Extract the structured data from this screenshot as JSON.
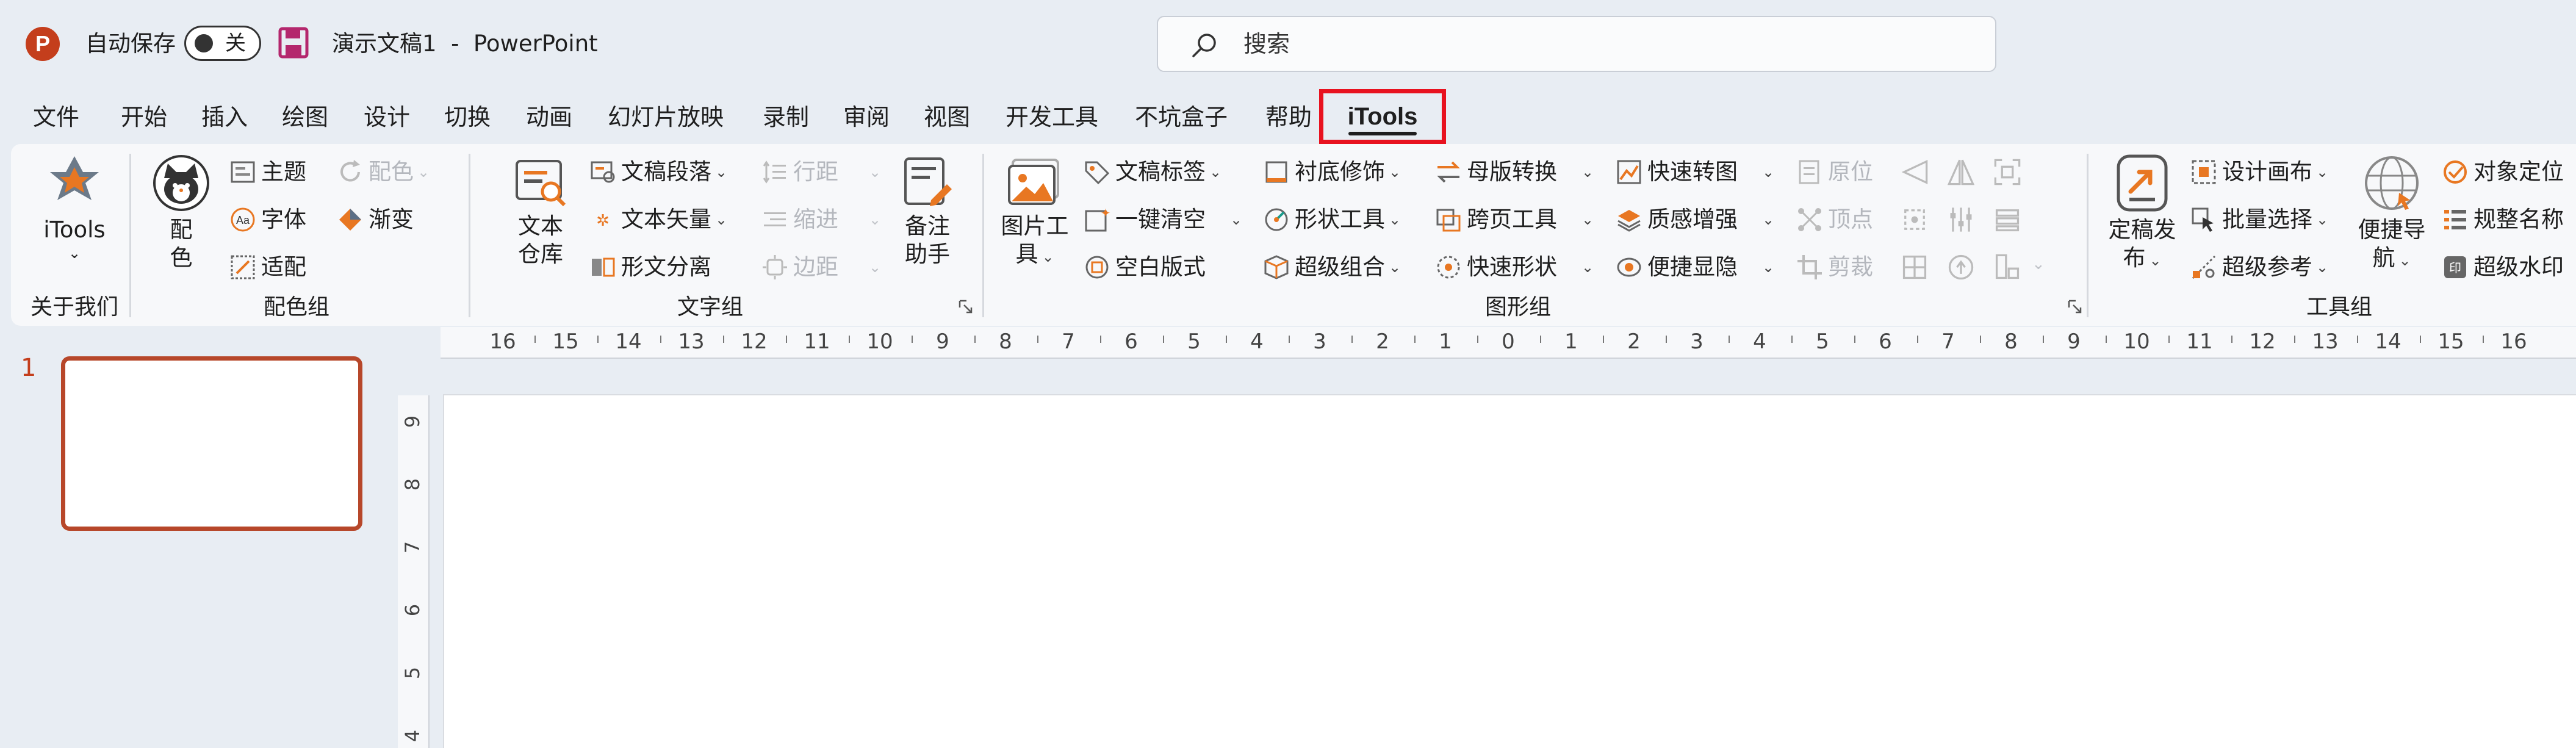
{
  "titlebar": {
    "app_logo": "P",
    "autosave_label": "自动保存",
    "autosave_state": "关",
    "doc_title": "演示文稿1  -  PowerPoint",
    "search_placeholder": "搜索"
  },
  "tabs": [
    "文件",
    "开始",
    "插入",
    "绘图",
    "设计",
    "切换",
    "动画",
    "幻灯片放映",
    "录制",
    "审阅",
    "视图",
    "开发工具",
    "不坑盒子",
    "帮助"
  ],
  "active_tab": "iTools",
  "ribbon": {
    "about": {
      "big_label": "iTools",
      "group": "关于我们"
    },
    "color": {
      "big_label_1": "配",
      "big_label_2": "色",
      "theme": "主题",
      "font": "字体",
      "fit": "适配",
      "color_menu": "配色",
      "gradient": "渐变",
      "group": "配色组"
    },
    "text": {
      "library_1": "文本",
      "library_2": "仓库",
      "paragraph": "文稿段落",
      "vector": "文本矢量",
      "split": "形文分离",
      "line_spacing": "行距",
      "indent": "缩进",
      "margin": "边距",
      "notes_1": "备注",
      "notes_2": "助手",
      "group": "文字组"
    },
    "shape": {
      "pic_tool_1": "图片工",
      "pic_tool_2": "具",
      "doc_tag": "文稿标签",
      "clear": "一键清空",
      "blank": "空白版式",
      "bg_fix": "衬底修饰",
      "shape_tool": "形状工具",
      "super_group": "超级组合",
      "master": "母版转换",
      "cross_page": "跨页工具",
      "quick_shape": "快速形状",
      "quick_chart": "快速转图",
      "texture": "质感增强",
      "show_hide": "便捷显隐",
      "origin": "原位",
      "vertex": "顶点",
      "crop": "剪裁",
      "group": "图形组"
    },
    "tools": {
      "publish_1": "定稿发",
      "publish_2": "布",
      "canvas": "设计画布",
      "batch": "批量选择",
      "ref": "超级参考",
      "nav_1": "便捷导",
      "nav_2": "航",
      "locate": "对象定位",
      "rename": "规整名称",
      "watermark": "超级水印",
      "group": "工具组"
    }
  },
  "ruler_h": [
    "16",
    "15",
    "14",
    "13",
    "12",
    "11",
    "10",
    "9",
    "8",
    "7",
    "6",
    "5",
    "4",
    "3",
    "2",
    "1",
    "0",
    "1",
    "2",
    "3",
    "4",
    "5",
    "6",
    "7",
    "8",
    "9",
    "10",
    "11",
    "12",
    "13",
    "14",
    "15",
    "16"
  ],
  "ruler_v": [
    "9",
    "8",
    "7",
    "6",
    "5",
    "4"
  ],
  "slides": {
    "thumb_number": "1"
  },
  "colors": {
    "accent": "#c43e1c",
    "highlight_box": "#e8121f",
    "background": "#e8edf3"
  }
}
